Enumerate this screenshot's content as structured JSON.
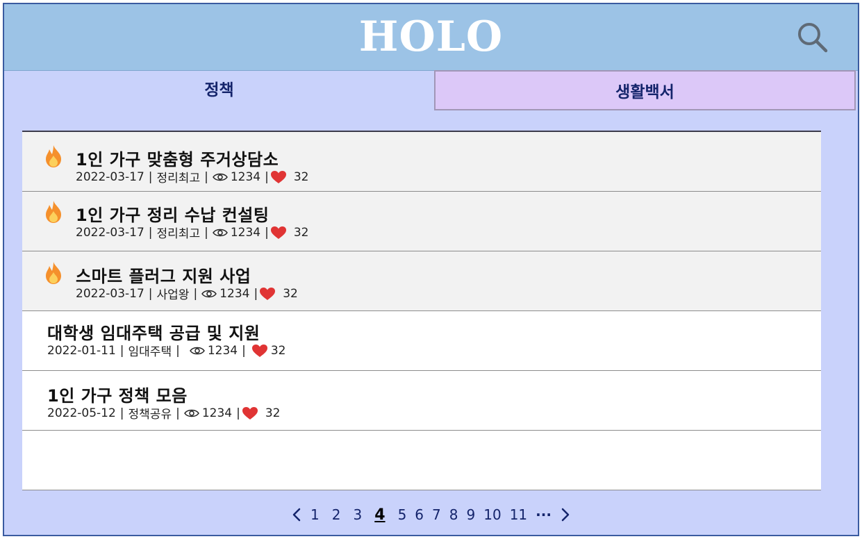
{
  "app": {
    "logo": "HOLO"
  },
  "tabs": [
    {
      "label": "정책",
      "active": true
    },
    {
      "label": "생활백서",
      "active": false
    }
  ],
  "posts": [
    {
      "title": "1인 가구 맞춤형 주거상담소",
      "date": "2022-03-17",
      "author": "정리최고",
      "views": "1234",
      "likes": "32",
      "hot": true
    },
    {
      "title": "1인 가구 정리 수납 컨설팅",
      "date": "2022-03-17",
      "author": "정리최고",
      "views": "1234",
      "likes": "32",
      "hot": true
    },
    {
      "title": "스마트 플러그 지원 사업",
      "date": "2022-03-17",
      "author": "사업왕",
      "views": "1234",
      "likes": "32",
      "hot": true
    },
    {
      "title": "대학생 임대주택 공급 및 지원",
      "date": "2022-01-11",
      "author": "임대주택",
      "views": "1234",
      "likes": "32",
      "hot": false
    },
    {
      "title": "1인 가구 정책 모음",
      "date": "2022-05-12",
      "author": "정책공유",
      "views": "1234",
      "likes": "32",
      "hot": false
    }
  ],
  "pagination": {
    "pages": [
      "1",
      "2",
      "3",
      "4",
      "5",
      "6",
      "7",
      "8",
      "9",
      "10",
      "11"
    ],
    "current": "4",
    "ellipsis": "···"
  },
  "colors": {
    "header": "#9cc3e6",
    "page_bg": "#c9d2fb",
    "tab_inactive": "#dcc8f8",
    "hot_row": "#f2f2f2",
    "heart": "#e03434",
    "fire": "#f5902c"
  },
  "icons": [
    "search-icon",
    "fire-icon",
    "eye-icon",
    "heart-icon",
    "chevron-left-icon",
    "chevron-right-icon"
  ]
}
